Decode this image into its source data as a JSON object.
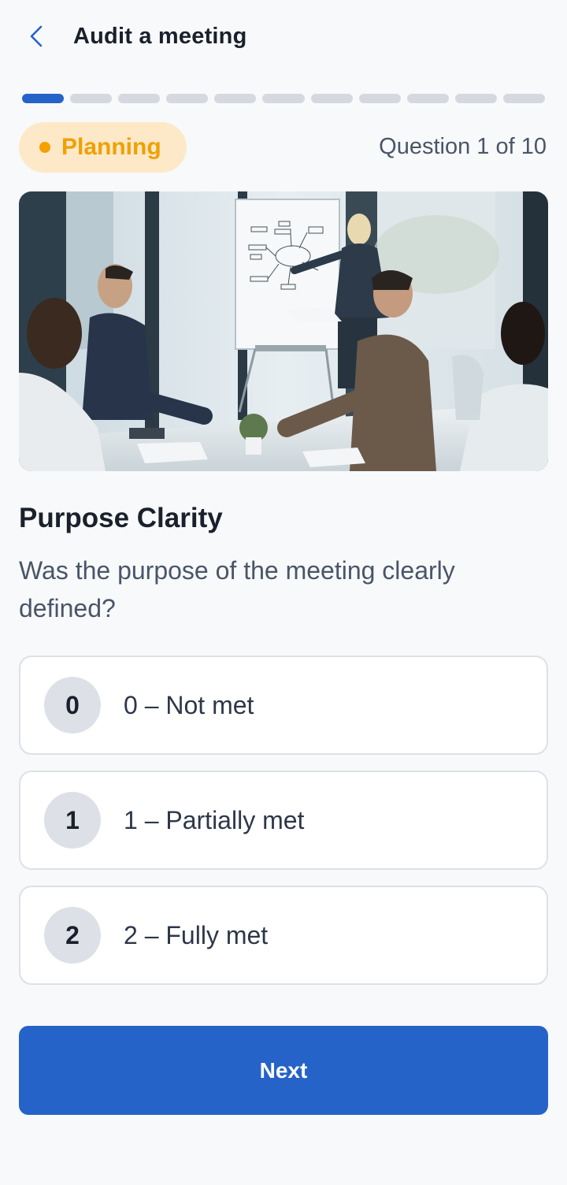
{
  "header": {
    "title": "Audit a meeting",
    "back_icon": "chevron-left-icon"
  },
  "progress": {
    "total_steps": 11,
    "current_step": 1
  },
  "category": {
    "label": "Planning",
    "color": "#f0a000"
  },
  "counter": "Question 1 of 10",
  "question": {
    "title": "Purpose Clarity",
    "text": "Was the purpose of the meeting clearly defined?"
  },
  "options": [
    {
      "number": "0",
      "label": "0 – Not met"
    },
    {
      "number": "1",
      "label": "1 – Partially met"
    },
    {
      "number": "2",
      "label": "2 – Fully met"
    }
  ],
  "next_label": "Next",
  "colors": {
    "accent": "#2563c9",
    "badge_bg": "#fde9c8",
    "badge_text": "#f0a000"
  }
}
